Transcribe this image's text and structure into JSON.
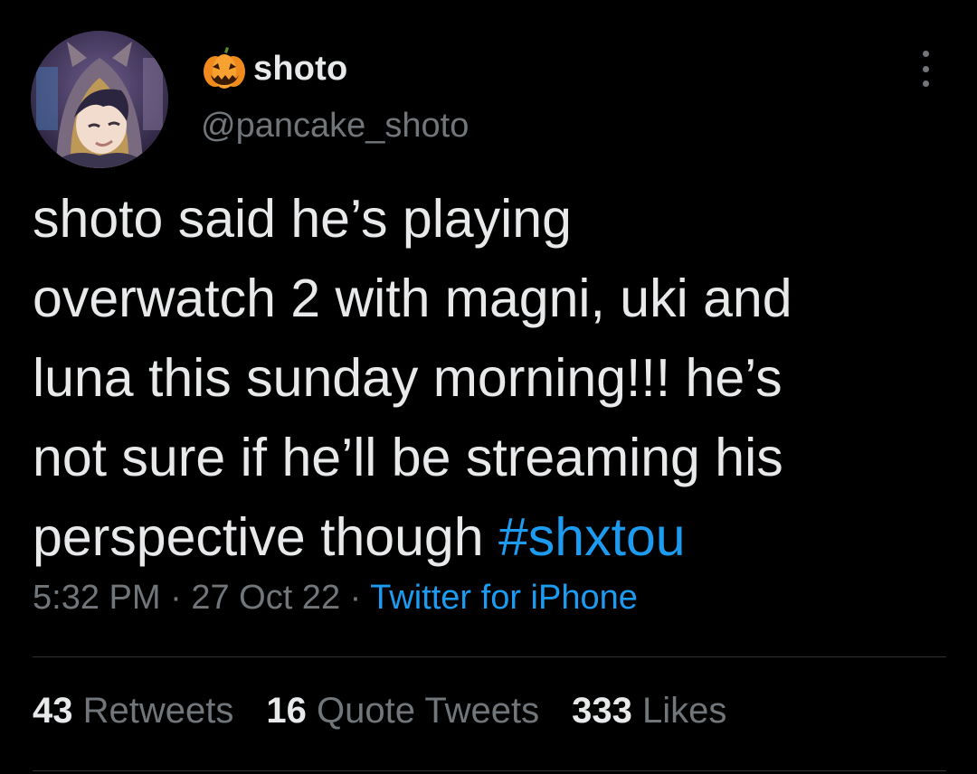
{
  "author": {
    "display_name": "shoto",
    "handle": "@pancake_shoto",
    "name_icon": "jack-o-lantern-emoji",
    "avatar": "anime-character-portrait"
  },
  "tweet": {
    "text": "shoto said he’s playing\noverwatch 2 with magni, uki and\nluna this sunday morning!!! he’s\nnot sure if he’ll be streaming his\nperspective though ",
    "hashtag": "#shxtou"
  },
  "meta": {
    "time": "5:32 PM",
    "sep1": " · ",
    "date": "27 Oct 22",
    "sep2": " · ",
    "source": "Twitter for iPhone"
  },
  "stats": {
    "retweets": {
      "count": "43",
      "label": "Retweets"
    },
    "quote_tweets": {
      "count": "16",
      "label": "Quote Tweets"
    },
    "likes": {
      "count": "333",
      "label": "Likes"
    }
  },
  "colors": {
    "background": "#000000",
    "text": "#e7e9ea",
    "secondary": "#71767b",
    "accent": "#1d9bf0",
    "divider": "#2f3336"
  }
}
